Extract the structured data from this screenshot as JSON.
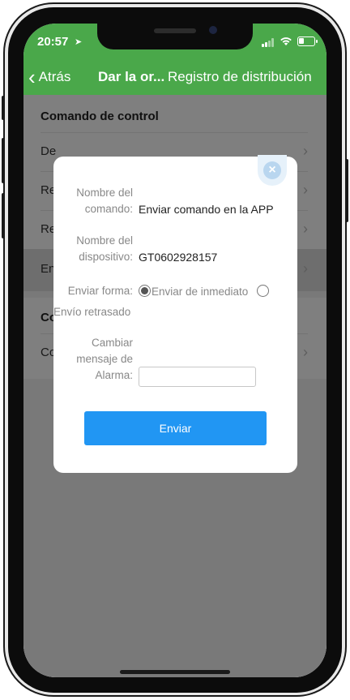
{
  "status": {
    "time": "20:57"
  },
  "nav": {
    "back_label": "Atrás",
    "title": "Dar la or...",
    "right_label": "Registro de distribución"
  },
  "page": {
    "section1_title": "Comando de control",
    "rows": [
      {
        "label": "De"
      },
      {
        "label": "Re"
      },
      {
        "label": "Re"
      },
      {
        "label": "En"
      }
    ],
    "section2_title": "Co",
    "section2_rows": [
      {
        "label": "Co"
      }
    ]
  },
  "modal": {
    "command_name_label_line1": "Nombre del",
    "command_name_label_line2": "comando:",
    "command_name_value": "Enviar comando en la APP",
    "device_name_label_line1": "Nombre del",
    "device_name_label_line2": "dispositivo:",
    "device_name_value": "GT0602928157",
    "send_mode_label": "Enviar forma:",
    "option_immediate": "Enviar de inmediato",
    "option_delayed": "Envío retrasado",
    "alarm_label_line1": "Cambiar",
    "alarm_label_line2": "mensaje de",
    "alarm_label_line3": "Alarma:",
    "alarm_value": "",
    "send_button": "Enviar",
    "close_glyph": "×"
  },
  "colors": {
    "header": "#4aa84a",
    "primary_button": "#2196f3"
  }
}
